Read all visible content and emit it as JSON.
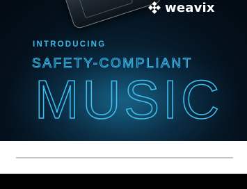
{
  "banner": {
    "brand": "weavix",
    "intro": "INTRODUCING",
    "subtitle": "SAFETY-COMPLIANT",
    "headline": "MUSIC",
    "accent_color": "#3ab8ea",
    "background_color": "#04101b",
    "logo_icon": "weavix-logo-icon",
    "device_image": "radio-device"
  },
  "page": {
    "divider_color": "#c4c4c4",
    "footer_color": "#000000"
  }
}
